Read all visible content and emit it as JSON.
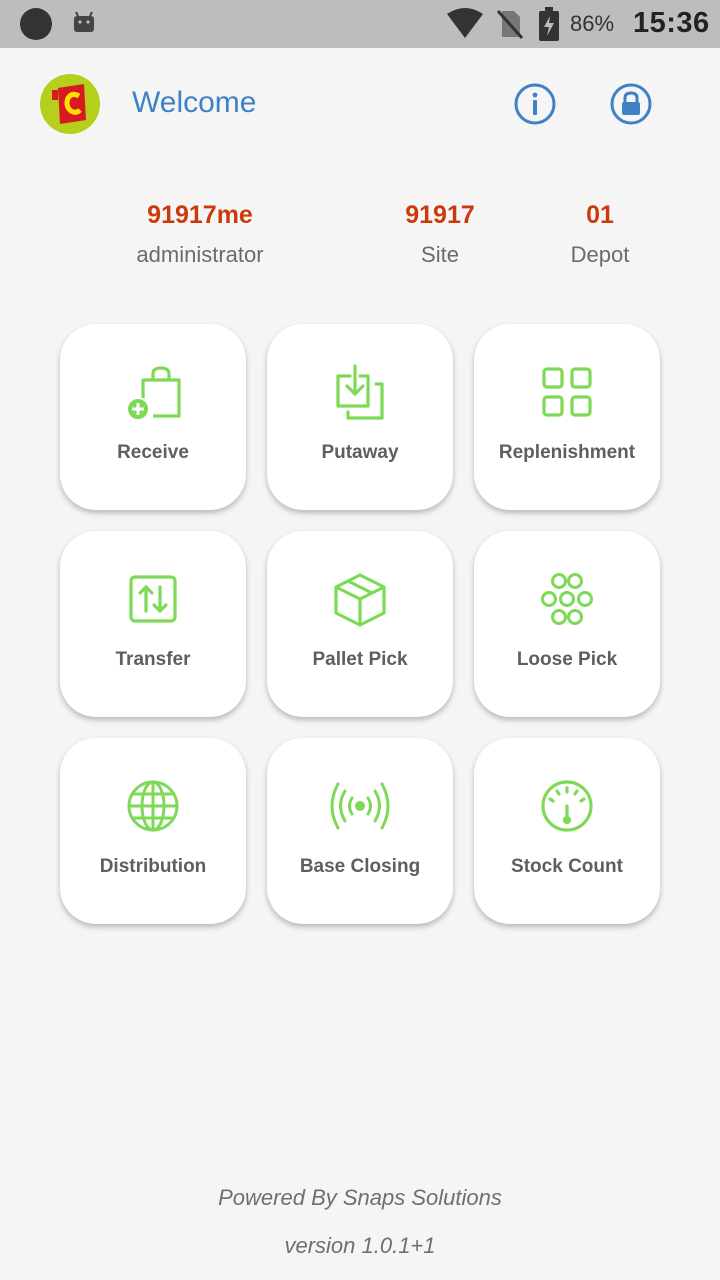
{
  "status_bar": {
    "battery_percent": "86%",
    "time": "15:36"
  },
  "header": {
    "welcome": "Welcome",
    "info_icon": "info-icon",
    "lock_icon": "lock-icon"
  },
  "user_info": [
    {
      "value": "91917me",
      "label": "administrator"
    },
    {
      "value": "91917",
      "label": "Site"
    },
    {
      "value": "01",
      "label": "Depot"
    }
  ],
  "menu": [
    {
      "label": "Receive",
      "icon": "bag-add-icon"
    },
    {
      "label": "Putaway",
      "icon": "download-stack-icon"
    },
    {
      "label": "Replenishment",
      "icon": "grid-icon"
    },
    {
      "label": "Transfer",
      "icon": "swap-vertical-icon"
    },
    {
      "label": "Pallet Pick",
      "icon": "box-icon"
    },
    {
      "label": "Loose Pick",
      "icon": "circles-cluster-icon"
    },
    {
      "label": "Distribution",
      "icon": "globe-icon"
    },
    {
      "label": "Base Closing",
      "icon": "broadcast-icon"
    },
    {
      "label": "Stock Count",
      "icon": "gauge-icon"
    }
  ],
  "footer": {
    "powered_by": "Powered By Snaps Solutions",
    "version": "version 1.0.1+1"
  },
  "colors": {
    "accent_green": "#7ed957",
    "welcome_blue": "#3f82c4",
    "value_red": "#cc3a0c"
  }
}
